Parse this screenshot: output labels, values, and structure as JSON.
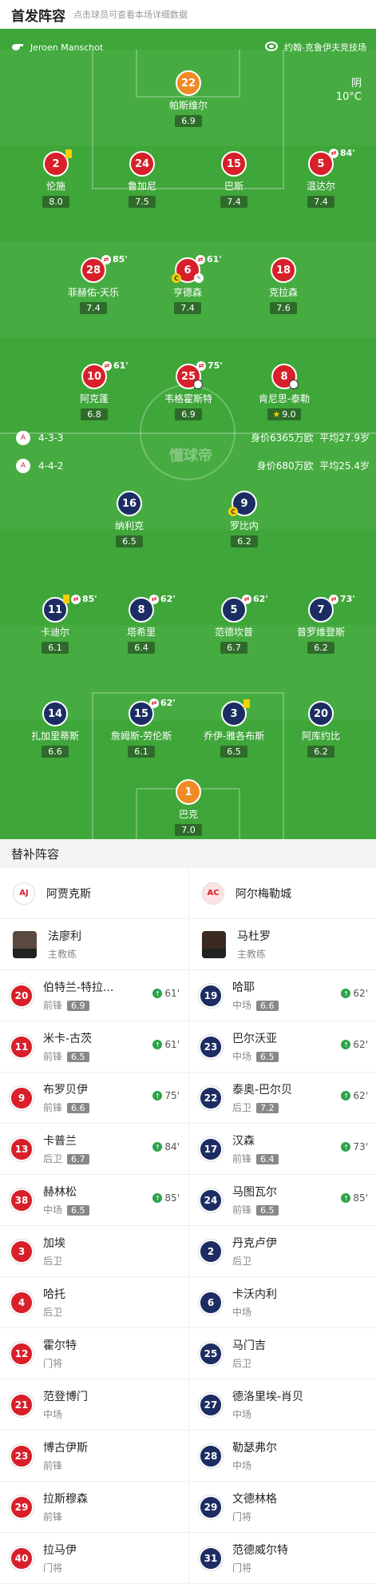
{
  "header": {
    "title": "首发阵容",
    "subtitle": "点击球员可查看本场详细数据"
  },
  "match_info": {
    "referee": "Jeroen Manschot",
    "stadium": "约翰-克鲁伊夫竞技场",
    "weather": "阴",
    "temperature": "10°C",
    "watermark": "懂球帝"
  },
  "home_form": {
    "formation": "4-3-3",
    "value": "身价6365万欧",
    "avg_age": "平均27.9岁"
  },
  "away_form": {
    "formation": "4-4-2",
    "value": "身价680万欧",
    "avg_age": "平均25.4岁"
  },
  "home_players": [
    {
      "num": "22",
      "name": "帕斯维尔",
      "rating": "6.9"
    },
    {
      "num": "2",
      "name": "伦施",
      "rating": "8.0"
    },
    {
      "num": "24",
      "name": "鲁加尼",
      "rating": "7.5"
    },
    {
      "num": "15",
      "name": "巴斯",
      "rating": "7.4"
    },
    {
      "num": "5",
      "name": "温达尔",
      "rating": "7.4",
      "sub": "84'"
    },
    {
      "num": "28",
      "name": "菲赫佑-天乐",
      "rating": "7.4",
      "sub": "85'"
    },
    {
      "num": "6",
      "name": "亨德森",
      "rating": "7.4",
      "sub": "61'"
    },
    {
      "num": "18",
      "name": "克拉森",
      "rating": "7.6"
    },
    {
      "num": "10",
      "name": "阿克蓬",
      "rating": "6.8",
      "sub": "61'"
    },
    {
      "num": "25",
      "name": "韦格霍斯特",
      "rating": "6.9",
      "sub": "75'"
    },
    {
      "num": "8",
      "name": "肯尼思-泰勒",
      "rating": "9.0"
    }
  ],
  "away_players": [
    {
      "num": "16",
      "name": "纳利克",
      "rating": "6.5"
    },
    {
      "num": "9",
      "name": "罗比内",
      "rating": "6.2"
    },
    {
      "num": "11",
      "name": "卡迪尔",
      "rating": "6.1",
      "sub": "85'"
    },
    {
      "num": "8",
      "name": "塔希里",
      "rating": "6.4",
      "sub": "62'"
    },
    {
      "num": "5",
      "name": "范德坎普",
      "rating": "6.7",
      "sub": "62'"
    },
    {
      "num": "7",
      "name": "普罗维登斯",
      "rating": "6.2",
      "sub": "73'"
    },
    {
      "num": "14",
      "name": "扎加里蒂斯",
      "rating": "6.6"
    },
    {
      "num": "15",
      "name": "詹姆斯-劳伦斯",
      "rating": "6.1",
      "sub": "62'"
    },
    {
      "num": "3",
      "name": "乔伊-雅各布斯",
      "rating": "6.5"
    },
    {
      "num": "20",
      "name": "阿库约比",
      "rating": "6.2"
    },
    {
      "num": "1",
      "name": "巴克",
      "rating": "7.0"
    }
  ],
  "subs": {
    "title": "替补阵容",
    "home_team": "阿贾克斯",
    "away_team": "阿尔梅勒城",
    "home_coach": {
      "name": "法廖利",
      "role": "主教练"
    },
    "away_coach": {
      "name": "马杜罗",
      "role": "主教练"
    },
    "home_list": [
      {
        "num": "20",
        "name": "伯特兰-特拉...",
        "pos": "前锋",
        "rating": "6.9",
        "in": "61'"
      },
      {
        "num": "11",
        "name": "米卡-古茨",
        "pos": "前锋",
        "rating": "6.5",
        "in": "61'"
      },
      {
        "num": "9",
        "name": "布罗贝伊",
        "pos": "前锋",
        "rating": "6.6",
        "in": "75'"
      },
      {
        "num": "13",
        "name": "卡普兰",
        "pos": "后卫",
        "rating": "6.7",
        "in": "84'"
      },
      {
        "num": "38",
        "name": "赫林松",
        "pos": "中场",
        "rating": "6.5",
        "in": "85'"
      },
      {
        "num": "3",
        "name": "加埃",
        "pos": "后卫"
      },
      {
        "num": "4",
        "name": "哈托",
        "pos": "后卫"
      },
      {
        "num": "12",
        "name": "霍尔特",
        "pos": "门将"
      },
      {
        "num": "21",
        "name": "范登博门",
        "pos": "中场"
      },
      {
        "num": "23",
        "name": "博古伊斯",
        "pos": "前锋"
      },
      {
        "num": "29",
        "name": "拉斯穆森",
        "pos": "前锋"
      },
      {
        "num": "40",
        "name": "拉马伊",
        "pos": "门将"
      }
    ],
    "away_list": [
      {
        "num": "19",
        "name": "哈耶",
        "pos": "中场",
        "rating": "6.6",
        "in": "62'"
      },
      {
        "num": "23",
        "name": "巴尔沃亚",
        "pos": "中场",
        "rating": "6.5",
        "in": "62'"
      },
      {
        "num": "22",
        "name": "泰奥-巴尔贝",
        "pos": "后卫",
        "rating": "7.2",
        "in": "62'"
      },
      {
        "num": "17",
        "name": "汉森",
        "pos": "前锋",
        "rating": "6.4",
        "in": "73'"
      },
      {
        "num": "24",
        "name": "马图瓦尔",
        "pos": "前锋",
        "rating": "6.5",
        "in": "85'"
      },
      {
        "num": "2",
        "name": "丹克卢伊",
        "pos": "后卫"
      },
      {
        "num": "6",
        "name": "卡沃内利",
        "pos": "中场"
      },
      {
        "num": "25",
        "name": "马门吉",
        "pos": "后卫"
      },
      {
        "num": "27",
        "name": "德洛里埃-肖贝",
        "pos": "中场"
      },
      {
        "num": "28",
        "name": "勒瑟弗尔",
        "pos": "中场"
      },
      {
        "num": "29",
        "name": "文德林格",
        "pos": "门将"
      },
      {
        "num": "31",
        "name": "范德威尔特",
        "pos": "门将"
      }
    ]
  }
}
